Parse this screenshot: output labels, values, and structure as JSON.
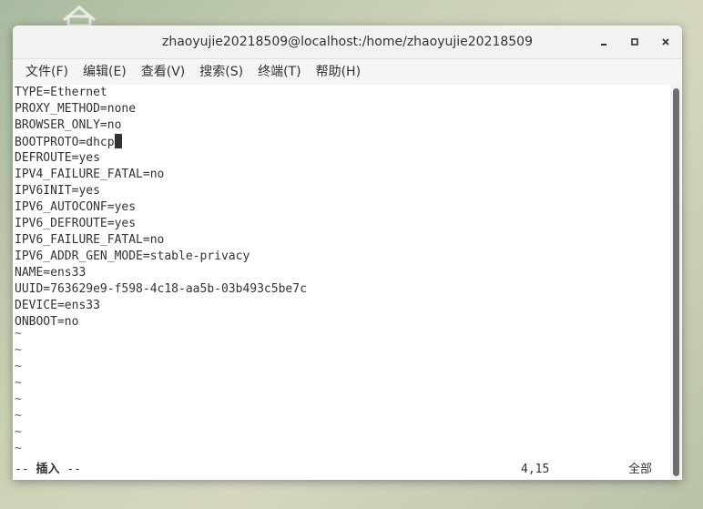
{
  "window": {
    "title": "zhaoyujie20218509@localhost:/home/zhaoyujie20218509"
  },
  "menu": {
    "items": [
      "文件(F)",
      "编辑(E)",
      "查看(V)",
      "搜索(S)",
      "终端(T)",
      "帮助(H)"
    ]
  },
  "editor": {
    "lines": [
      "TYPE=Ethernet",
      "PROXY_METHOD=none",
      "BROWSER_ONLY=no",
      "BOOTPROTO=dhcp",
      "DEFROUTE=yes",
      "IPV4_FAILURE_FATAL=no",
      "IPV6INIT=yes",
      "IPV6_AUTOCONF=yes",
      "IPV6_DEFROUTE=yes",
      "IPV6_FAILURE_FATAL=no",
      "IPV6_ADDR_GEN_MODE=stable-privacy",
      "NAME=ens33",
      "UUID=763629e9-f598-4c18-aa5b-03b493c5be7c",
      "DEVICE=ens33",
      "ONBOOT=no"
    ],
    "tilde": "~",
    "cursor_line": 4,
    "cursor_col": 15
  },
  "status": {
    "mode_prefix": "-- ",
    "mode": "插入",
    "mode_suffix": " --",
    "position": "4,15",
    "scroll": "全部"
  }
}
